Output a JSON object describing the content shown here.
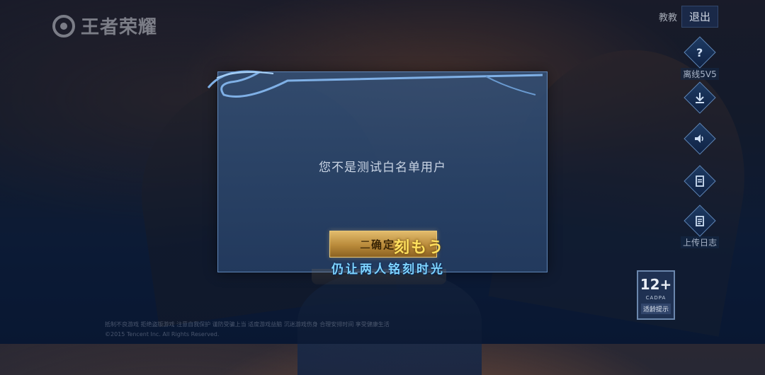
{
  "logo": {
    "text": "王者荣耀"
  },
  "top_bar": {
    "label": "教教",
    "exit_label": "退出"
  },
  "side_menu": {
    "items": [
      {
        "icon": "help-icon",
        "label": "离线5V5"
      },
      {
        "icon": "download-icon",
        "label": ""
      },
      {
        "icon": "speaker-icon",
        "label": ""
      },
      {
        "icon": "document-icon",
        "label": ""
      },
      {
        "icon": "upload-log-icon",
        "label": "上传日志"
      }
    ]
  },
  "dialog": {
    "message": "您不是测试白名单用户",
    "confirm_label": "确定",
    "confirm_prefix": "二",
    "overlay_text": "刻もう"
  },
  "subtitle": "仍让两人铭刻时光",
  "age_rating": {
    "rating": "12+",
    "org": "CADPA",
    "tip": "适龄提示"
  },
  "footer": {
    "line1": "抵制不良游戏 拒绝盗版游戏 注意自我保护 谨防受骗上当 适度游戏益脑 沉迷游戏伤身 合理安排时间 享受健康生活",
    "line2": "©2015 Tencent Inc. All Rights Reserved."
  },
  "colors": {
    "accent_gold": "#e2bb6c",
    "dialog_border": "#5f86b8",
    "subtitle_blue": "#7fd4ff"
  }
}
